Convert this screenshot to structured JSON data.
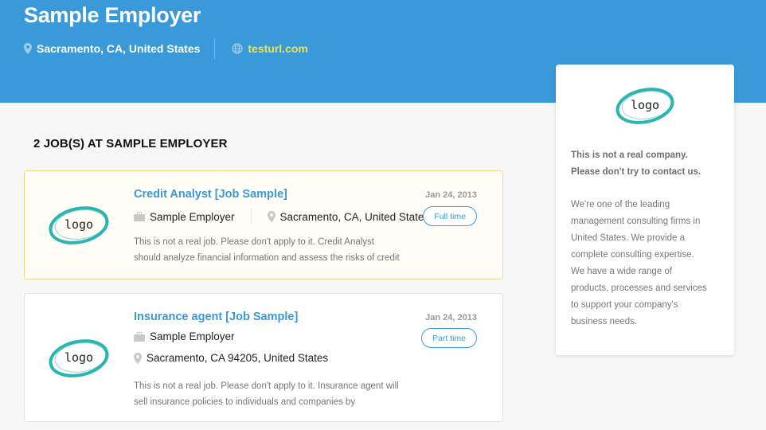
{
  "employer": {
    "name": "Sample Employer",
    "location": "Sacramento, CA, United States",
    "website": "testurl.com",
    "icons": {
      "location": "map-pin-icon",
      "website": "globe-icon"
    }
  },
  "jobs_heading": "2 JOB(S) AT SAMPLE EMPLOYER",
  "jobs": [
    {
      "title": "Credit Analyst [Job Sample]",
      "date": "Jan 24, 2013",
      "company": "Sample Employer",
      "location": "Sacramento, CA, United States",
      "type": "Full time",
      "logo_text": "logo",
      "description_lines": [
        "This is not a real job. Please don't apply to it. Credit Analyst",
        "should analyze financial information and assess the risks of credit"
      ]
    },
    {
      "title": "Insurance agent [Job Sample]",
      "date": "Jan 24, 2013",
      "company": "Sample Employer",
      "location": "Sacramento, CA 94205, United States",
      "type": "Part time",
      "logo_text": "logo",
      "description_lines": [
        "This is not a real job. Please don't apply to it. Insurance agent will",
        "sell insurance policies to individuals and companies by"
      ]
    }
  ],
  "sidebar": {
    "logo_text": "logo",
    "disclaimer_lines": [
      "This is not a real company.",
      "Please don't try to contact us."
    ],
    "about_lines": [
      "We're one of the leading",
      "management consulting firms in",
      "United States. We provide a",
      "complete consulting expertise.",
      "We have a wide range of",
      "products, processes and services",
      "to support your company's",
      "business needs."
    ]
  },
  "colors": {
    "hero": "#3a9ad9",
    "accent": "#3a9ad9",
    "website_link": "#f4e04d",
    "featured_border": "#f5d98a",
    "logo_swoosh": "#2bb5b0"
  }
}
